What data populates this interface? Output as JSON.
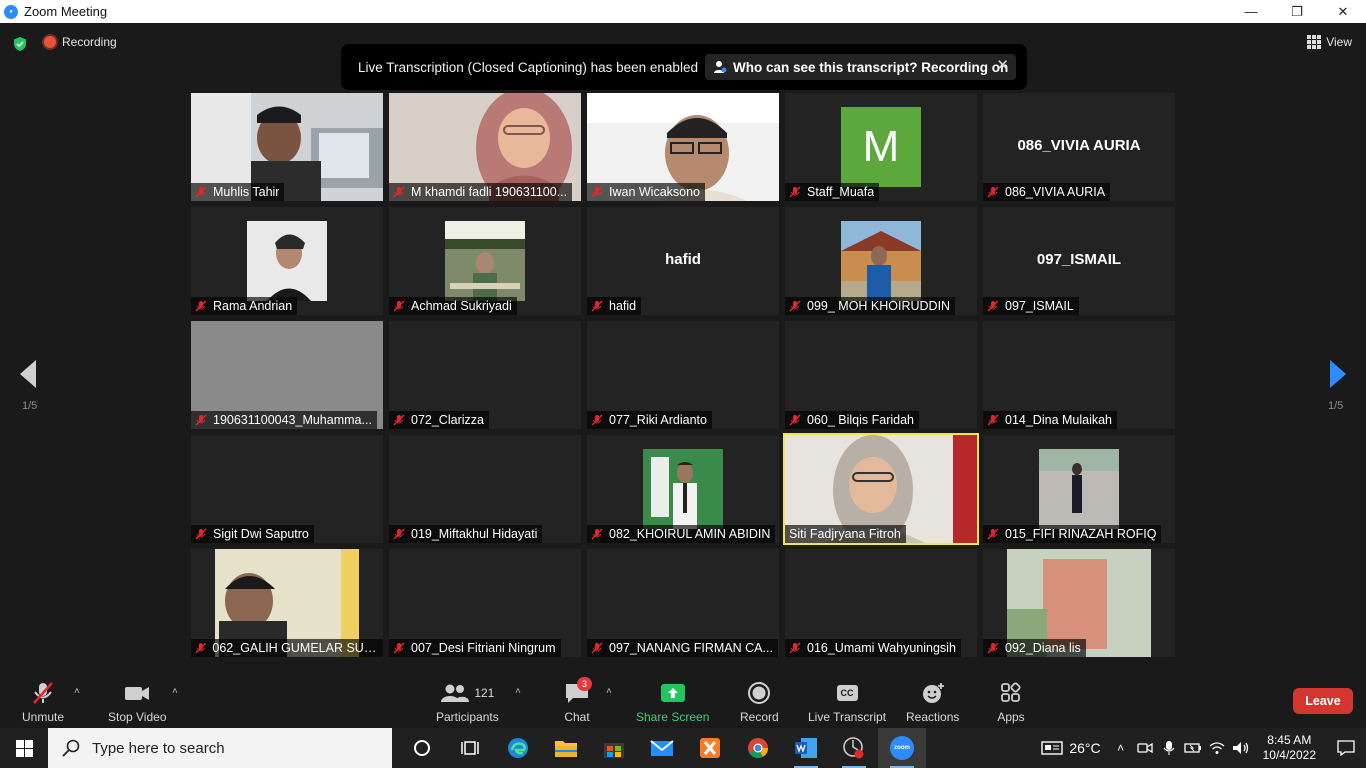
{
  "window": {
    "title": "Zoom Meeting"
  },
  "top": {
    "recording_label": "Recording",
    "view_label": "View"
  },
  "banner": {
    "text": "Live Transcription (Closed Captioning) has been enabled",
    "link": "Who can see this transcript? Recording on"
  },
  "pagination": {
    "left": "1/5",
    "right": "1/5"
  },
  "tiles": [
    {
      "name": "Muhlis Tahir"
    },
    {
      "name": "M khamdi fadli 190631100..."
    },
    {
      "name": "Iwan Wicaksono"
    },
    {
      "name": "Staff_Muafa",
      "avatar_letter": "M"
    },
    {
      "name": "086_VIVIA AURIA",
      "big_name": "086_VIVIA AURIA"
    },
    {
      "name": "Rama Andrian"
    },
    {
      "name": "Achmad Sukriyadi"
    },
    {
      "name": "hafid",
      "big_name": "hafid"
    },
    {
      "name": "099_ MOH KHOIRUDDIN"
    },
    {
      "name": "097_ISMAIL",
      "big_name": "097_ISMAIL"
    },
    {
      "name": "190631100043_Muhamma..."
    },
    {
      "name": "072_Clarizza"
    },
    {
      "name": "077_Riki Ardianto"
    },
    {
      "name": "060_ Bilqis Faridah"
    },
    {
      "name": "014_Dina Mulaikah"
    },
    {
      "name": "Sigit Dwi Saputro"
    },
    {
      "name": "019_Miftakhul Hidayati"
    },
    {
      "name": "082_KHOIRUL AMIN ABIDIN"
    },
    {
      "name": "Siti Fadjryana Fitroh"
    },
    {
      "name": "015_FIFI RINAZAH ROFIQ"
    },
    {
      "name": "062_GALIH GUMELAR SUDI..."
    },
    {
      "name": "007_Desi Fitriani Ningrum"
    },
    {
      "name": "097_NANANG FIRMAN CA..."
    },
    {
      "name": "016_Umami Wahyuningsih"
    },
    {
      "name": "092_Diana lis"
    }
  ],
  "toolbar": {
    "unmute": "Unmute",
    "stop_video": "Stop Video",
    "participants": "Participants",
    "participants_count": "121",
    "chat": "Chat",
    "chat_badge": "3",
    "share_screen": "Share Screen",
    "record": "Record",
    "live_transcript": "Live Transcript",
    "live_transcript_icon_text": "CC",
    "reactions": "Reactions",
    "apps": "Apps",
    "leave": "Leave"
  },
  "taskbar": {
    "search_placeholder": "Type here to search",
    "temperature": "26°C",
    "time": "8:45 AM",
    "date": "10/4/2022",
    "zoom_icon_text": "zoom"
  },
  "colors": {
    "accent_green": "#3cd07a",
    "leave_red": "#d3362f",
    "active_speaker": "#f3e64b",
    "zoom_blue": "#2d8cff"
  }
}
